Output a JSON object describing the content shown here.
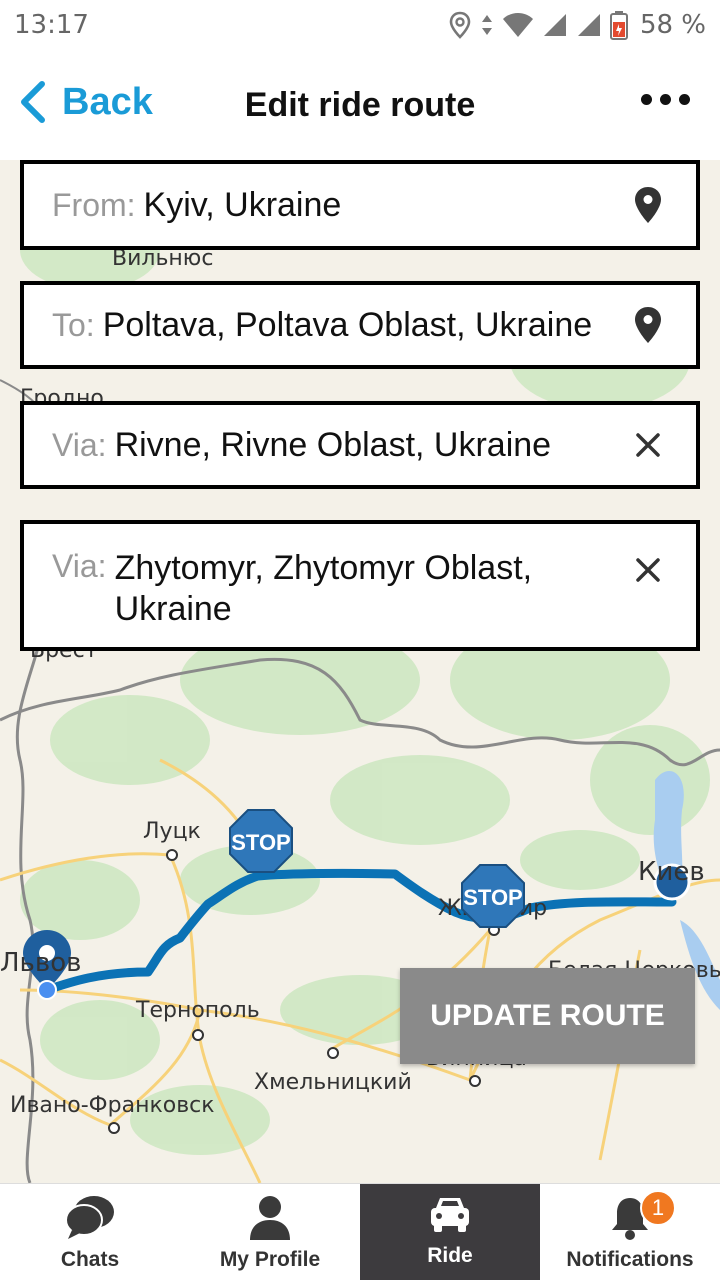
{
  "status_bar": {
    "time": "13:17",
    "battery": "58 %"
  },
  "header": {
    "back_label": "Back",
    "title": "Edit ride route"
  },
  "route": {
    "from": {
      "prefix": "From:",
      "value": "Kyiv, Ukraine",
      "icon": "location-pin-icon"
    },
    "to": {
      "prefix": "To:",
      "value": "Poltava, Poltava Oblast, Ukraine",
      "icon": "location-pin-icon"
    },
    "vias": [
      {
        "prefix": "Via:",
        "value": "Rivne, Rivne Oblast, Ukraine",
        "icon": "close-icon"
      },
      {
        "prefix": "Via:",
        "value": "Zhytomyr, Zhytomyr Oblast, Ukraine",
        "icon": "close-icon"
      }
    ]
  },
  "map": {
    "labels": {
      "vilnius": "Вильнюс",
      "grodno": "Гродно",
      "brest": "Брест",
      "lutsk": "Луцк",
      "lviv": "Львов",
      "ternopil": "Тернополь",
      "khmelnytskyi": "Хмельницкий",
      "ivano_frankivsk": "Ивано-Франковск",
      "vinnytsia": "Винница",
      "zhytomyr": "Житомир",
      "kyiv": "Киев",
      "bila_tserkva": "Белая Церковь"
    },
    "stop_label": "STOP",
    "route_color": "#0b72b5",
    "marker_color": "#1f5f9e"
  },
  "actions": {
    "update_route": "UPDATE ROUTE"
  },
  "bottom_nav": [
    {
      "label": "Chats",
      "icon": "chat-bubbles-icon"
    },
    {
      "label": "My Profile",
      "icon": "person-icon"
    },
    {
      "label": "Ride",
      "icon": "car-icon",
      "active": true
    },
    {
      "label": "Notifications",
      "icon": "bell-icon",
      "badge": "1"
    }
  ]
}
